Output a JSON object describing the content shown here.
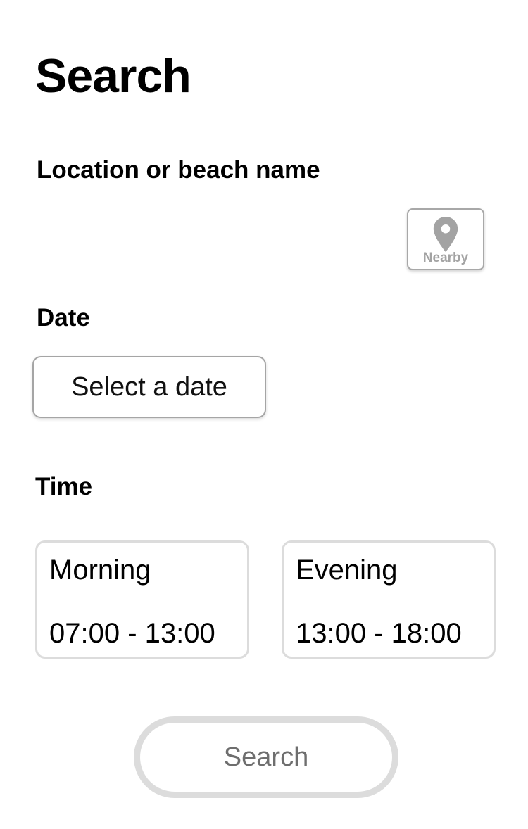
{
  "page": {
    "title": "Search"
  },
  "location": {
    "label": "Location or beach name",
    "placeholder": "",
    "value": "",
    "nearby_label": "Nearby",
    "nearby_icon": "map-pin-icon"
  },
  "date": {
    "label": "Date",
    "button_label": "Select a date"
  },
  "time": {
    "label": "Time",
    "options": [
      {
        "period": "Morning",
        "range": "07:00 - 13:00"
      },
      {
        "period": "Evening",
        "range": "13:00 - 18:00"
      }
    ]
  },
  "actions": {
    "search_label": "Search"
  },
  "colors": {
    "text": "#000000",
    "border_light": "#dcdcdc",
    "border_mid": "#a5a5a5",
    "muted_text": "#6e6e6e",
    "icon_gray": "#a3a3a3"
  }
}
